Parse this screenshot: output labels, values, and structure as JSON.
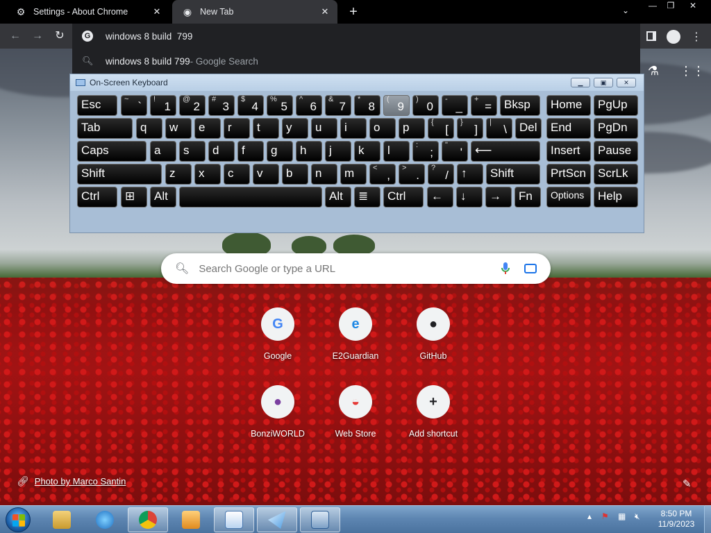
{
  "tabs": [
    {
      "title": "Settings - About Chrome",
      "icon": "gear-icon"
    },
    {
      "title": "New Tab",
      "icon": "chrome-icon"
    }
  ],
  "omnibox": {
    "text": "windows 8 build  799"
  },
  "suggestion": {
    "query": "windows 8 build 799",
    "suffix": " - Google Search"
  },
  "osk": {
    "title": "On-Screen Keyboard",
    "rows": [
      [
        {
          "l": "Esc"
        },
        {
          "s": "~",
          "b": "`"
        },
        {
          "s": "!",
          "b": "1"
        },
        {
          "s": "@",
          "b": "2"
        },
        {
          "s": "#",
          "b": "3"
        },
        {
          "s": "$",
          "b": "4"
        },
        {
          "s": "%",
          "b": "5"
        },
        {
          "s": "^",
          "b": "6"
        },
        {
          "s": "&",
          "b": "7"
        },
        {
          "s": "*",
          "b": "8"
        },
        {
          "s": "(",
          "b": "9"
        },
        {
          "s": ")",
          "b": "0"
        },
        {
          "s": "-",
          "b": "_"
        },
        {
          "s": "+",
          "b": "="
        },
        {
          "l": "Bksp"
        },
        {
          "l": "Home"
        },
        {
          "l": "PgUp"
        }
      ],
      [
        {
          "l": "Tab"
        },
        {
          "l": "q"
        },
        {
          "l": "w"
        },
        {
          "l": "e"
        },
        {
          "l": "r"
        },
        {
          "l": "t"
        },
        {
          "l": "y"
        },
        {
          "l": "u"
        },
        {
          "l": "i"
        },
        {
          "l": "o"
        },
        {
          "l": "p"
        },
        {
          "s": "{",
          "b": "["
        },
        {
          "s": "}",
          "b": "]"
        },
        {
          "s": "|",
          "b": "\\"
        },
        {
          "l": "Del"
        },
        {
          "l": "End"
        },
        {
          "l": "PgDn"
        }
      ],
      [
        {
          "l": "Caps"
        },
        {
          "l": "a"
        },
        {
          "l": "s"
        },
        {
          "l": "d"
        },
        {
          "l": "f"
        },
        {
          "l": "g"
        },
        {
          "l": "h"
        },
        {
          "l": "j"
        },
        {
          "l": "k"
        },
        {
          "l": "l"
        },
        {
          "s": ":",
          "b": ";"
        },
        {
          "s": "\"",
          "b": "'"
        },
        {
          "l": "⟵"
        },
        {
          "l": "Insert"
        },
        {
          "l": "Pause"
        }
      ],
      [
        {
          "l": "Shift"
        },
        {
          "l": "z"
        },
        {
          "l": "x"
        },
        {
          "l": "c"
        },
        {
          "l": "v"
        },
        {
          "l": "b"
        },
        {
          "l": "n"
        },
        {
          "l": "m"
        },
        {
          "s": "<",
          "b": ","
        },
        {
          "s": ">",
          "b": "."
        },
        {
          "s": "?",
          "b": "/"
        },
        {
          "l": "↑"
        },
        {
          "l": "Shift"
        },
        {
          "l": "PrtScn"
        },
        {
          "l": "ScrLk"
        }
      ],
      [
        {
          "l": "Ctrl"
        },
        {
          "l": "⊞"
        },
        {
          "l": "Alt"
        },
        {
          "l": ""
        },
        {
          "l": "Alt"
        },
        {
          "l": "≣"
        },
        {
          "l": "Ctrl"
        },
        {
          "l": "←"
        },
        {
          "l": "↓"
        },
        {
          "l": "→"
        },
        {
          "l": "Fn"
        },
        {
          "l": "Options"
        },
        {
          "l": "Help"
        }
      ]
    ]
  },
  "search": {
    "placeholder": "Search Google or type a URL"
  },
  "shortcuts": [
    {
      "label": "Google",
      "icon": "google-icon",
      "glyph": "G",
      "color": "#4285f4"
    },
    {
      "label": "E2Guardian",
      "icon": "e2guardian-icon",
      "glyph": "e",
      "color": "#1e88e5"
    },
    {
      "label": "GitHub",
      "icon": "github-icon",
      "glyph": "●",
      "color": "#202124"
    },
    {
      "label": "BonziWORLD",
      "icon": "bonziworld-icon",
      "glyph": "●",
      "color": "#7b3fa0"
    },
    {
      "label": "Web Store",
      "icon": "webstore-icon",
      "glyph": "◒",
      "color": "#e53935"
    },
    {
      "label": "Add shortcut",
      "icon": "plus-icon",
      "glyph": "+",
      "color": "#202124"
    }
  ],
  "attribution": {
    "text": "Photo by Marco Santin"
  },
  "taskbar": {
    "time": "8:50 PM",
    "date": "11/9/2023",
    "apps": [
      "file-explorer-icon",
      "internet-explorer-icon",
      "chrome-icon",
      "media-player-icon",
      "wordpad-icon",
      "paper-plane-icon",
      "on-screen-keyboard-icon"
    ]
  }
}
